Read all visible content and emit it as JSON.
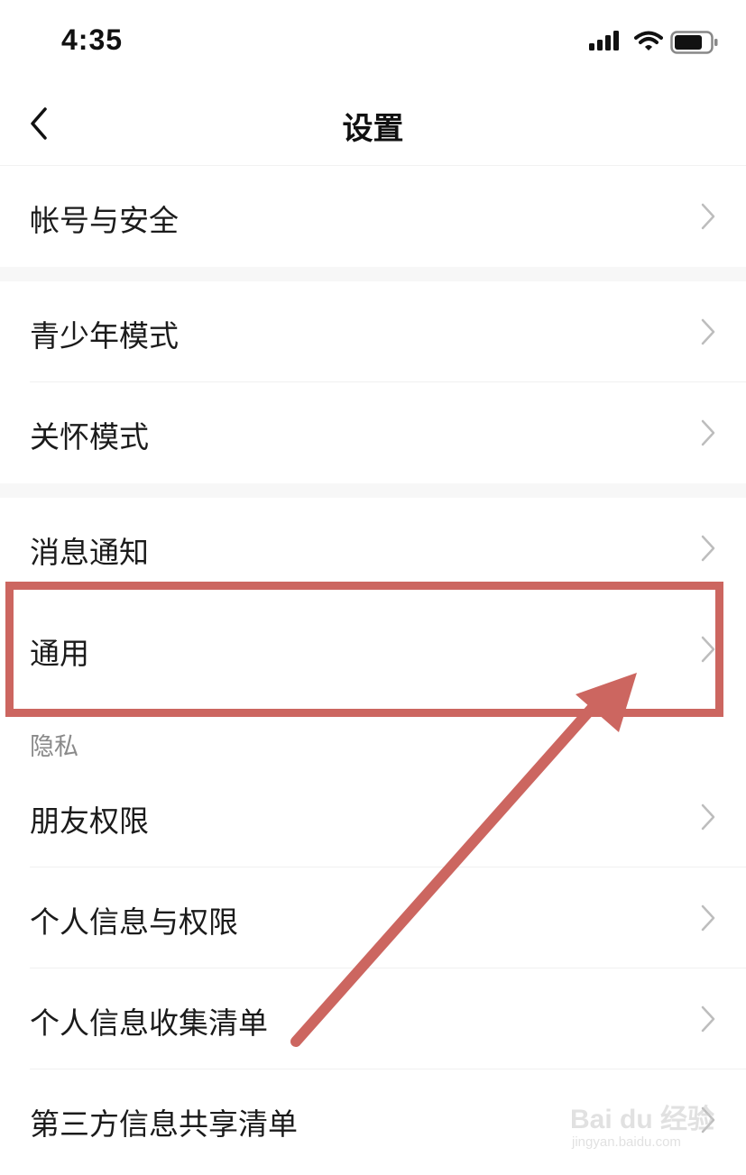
{
  "status_bar": {
    "time": "4:35"
  },
  "nav": {
    "title": "设置"
  },
  "groups": [
    {
      "items": [
        {
          "label": "帐号与安全"
        }
      ]
    },
    {
      "items": [
        {
          "label": "青少年模式"
        },
        {
          "label": "关怀模式"
        }
      ]
    },
    {
      "items": [
        {
          "label": "消息通知"
        },
        {
          "label": "通用"
        }
      ]
    }
  ],
  "privacy_section": {
    "header": "隐私",
    "items": [
      {
        "label": "朋友权限"
      },
      {
        "label": "个人信息与权限"
      },
      {
        "label": "个人信息收集清单"
      },
      {
        "label": "第三方信息共享清单"
      }
    ]
  },
  "annotation": {
    "highlight_color": "#cc6660",
    "highlighted_item": "通用"
  },
  "watermark": {
    "brand": "Bai du 经验",
    "url": "jingyan.baidu.com"
  }
}
